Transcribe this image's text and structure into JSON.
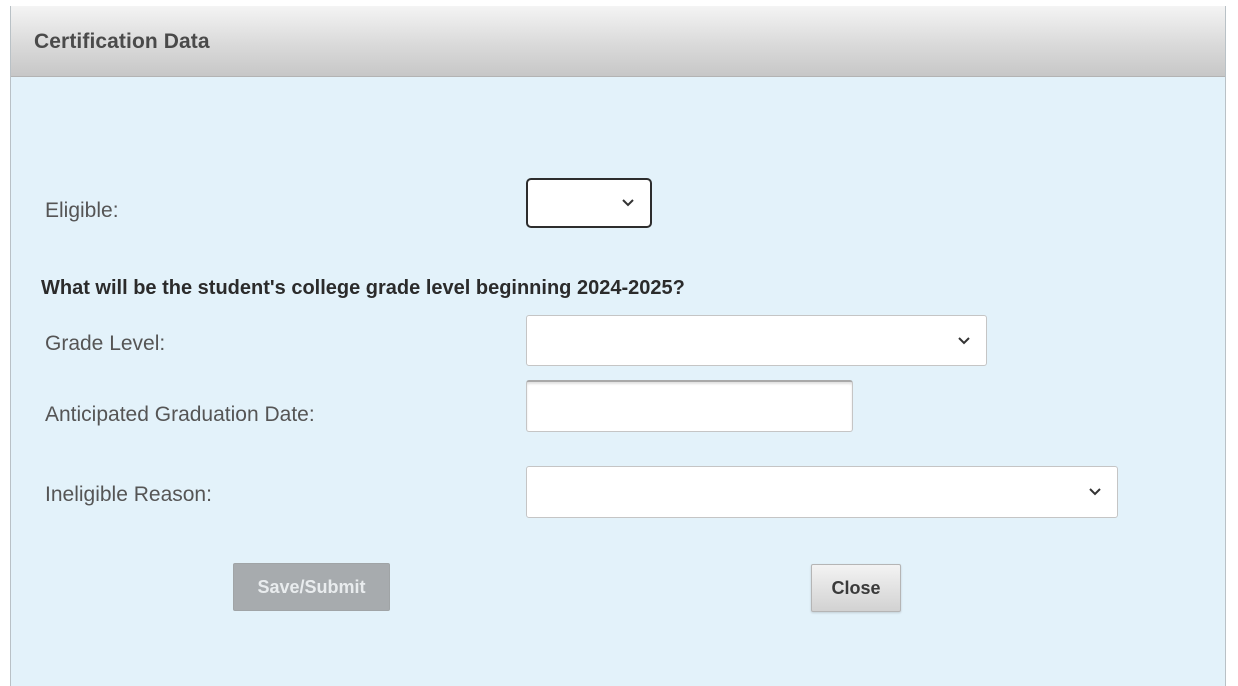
{
  "dialog": {
    "title": "Certification Data"
  },
  "form": {
    "eligible_label": "Eligible:",
    "eligible_value": "",
    "question": "What will be the student's college grade level beginning 2024-2025?",
    "grade_level_label": "Grade Level:",
    "grade_level_value": "",
    "graduation_date_label": "Anticipated Graduation Date:",
    "graduation_date_value": "",
    "ineligible_reason_label": "Ineligible Reason:",
    "ineligible_reason_value": ""
  },
  "buttons": {
    "save_label": "Save/Submit",
    "close_label": "Close"
  },
  "icons": {
    "dropdown": "chevron-down-icon"
  },
  "colors": {
    "panel_background": "#e3f2fa",
    "disabled_button": "#a7abae"
  }
}
